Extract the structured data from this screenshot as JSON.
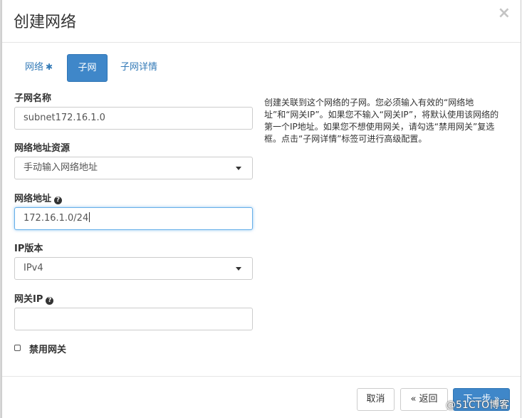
{
  "dialog": {
    "title": "创建网络",
    "close_glyph": "×"
  },
  "tabs": [
    {
      "label": "网络",
      "required_mark": "✱",
      "active": false
    },
    {
      "label": "子网",
      "active": true
    },
    {
      "label": "子网详情",
      "active": false
    }
  ],
  "fields": {
    "subnet_name": {
      "label": "子网名称",
      "value": "subnet172.16.1.0"
    },
    "address_source": {
      "label": "网络地址资源",
      "value": "手动输入网络地址"
    },
    "network_address": {
      "label": "网络地址",
      "value": "172.16.1.0/24"
    },
    "ip_version": {
      "label": "IP版本",
      "value": "IPv4"
    },
    "gateway_ip": {
      "label": "网关IP",
      "value": ""
    },
    "disable_gateway": {
      "label": "禁用网关",
      "checked": false
    }
  },
  "help_text": "创建关联到这个网络的子网。您必须输入有效的“网络地址”和“网关IP”。如果您不输入“网关IP”，将默认使用该网络的第一个IP地址。如果您不想使用网关，请勾选“禁用网关”复选框。点击“子网详情”标签可进行高级配置。",
  "footer": {
    "cancel_label": "取消",
    "back_label": "« 返回",
    "next_label": "下一步 »"
  },
  "watermark": "@51CTO博客",
  "colors": {
    "primary": "#3f87c9",
    "link": "#337ab7",
    "focus": "#66afe9"
  }
}
